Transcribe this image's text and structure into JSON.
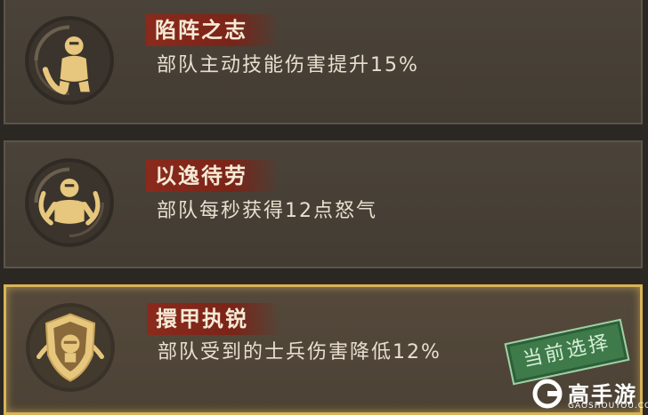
{
  "skills": [
    {
      "title": "陷阵之志",
      "description": "部队主动技能伤害提升15%",
      "emblem_icon": "armored-soldier-icon"
    },
    {
      "title": "以逸待劳",
      "description": "部队每秒获得12点怒气",
      "emblem_icon": "resting-soldier-icon"
    },
    {
      "title": "擐甲执锐",
      "description": "部队受到的士兵伤害降低12%",
      "emblem_icon": "shield-helmet-icon",
      "selected": true
    }
  ],
  "selected_stamp": "当前选择",
  "watermark": {
    "name": "高手游",
    "domain": "GAOSHOUYOU.COM"
  },
  "colors": {
    "accent_gold": "#d9b357",
    "banner_red": "#8a2a1c",
    "stamp_green": "#3e7a4a"
  }
}
